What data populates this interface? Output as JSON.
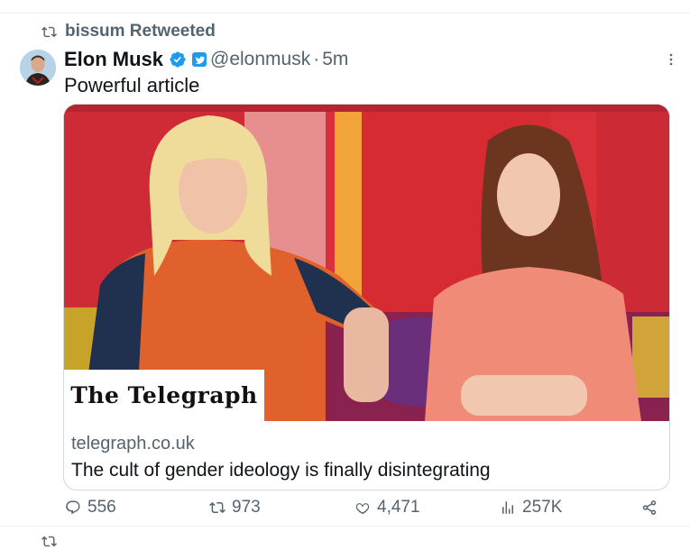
{
  "retweet": {
    "label": "bissum Retweeted",
    "icon": "retweet-icon"
  },
  "tweet": {
    "author": "Elon Musk",
    "handle": "@elonmusk",
    "separator": "·",
    "time": "5m",
    "text": "Powerful article"
  },
  "card": {
    "logo": "The Telegraph",
    "domain": "telegraph.co.uk",
    "title": "The cult of gender ideology is finally disintegrating"
  },
  "actions": {
    "replies": "556",
    "retweets": "973",
    "likes": "4,471",
    "views": "257K"
  },
  "colors": {
    "accent": "#1d9bf0",
    "muted": "#536471",
    "text": "#0f1419"
  }
}
